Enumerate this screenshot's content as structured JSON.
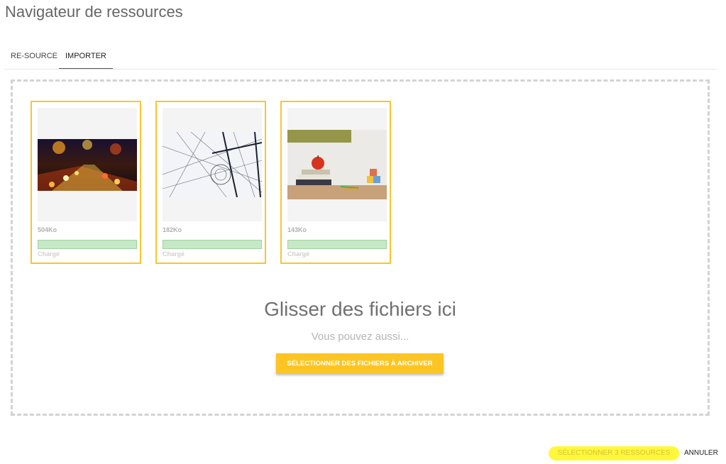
{
  "dialog": {
    "title": "Navigateur de ressources"
  },
  "tabs": [
    {
      "label": "RE-SOURCE",
      "active": false
    },
    {
      "label": "IMPORTER",
      "active": true
    }
  ],
  "uploads": [
    {
      "size": "504Ko",
      "status": "Chargé",
      "progress": 1.0
    },
    {
      "size": "182Ko",
      "status": "Chargé",
      "progress": 1.0
    },
    {
      "size": "143Ko",
      "status": "Chargé",
      "progress": 1.0
    }
  ],
  "dropzone": {
    "title": "Glisser des fichiers ici",
    "subtitle": "Vous pouvez aussi...",
    "select_button": "SÉLECTIONNER DES FICHIERS À ARCHIVER"
  },
  "footer": {
    "select_label": "SÉLECTIONNER 3 RESSOURCES",
    "cancel_label": "ANNULER"
  },
  "colors": {
    "accent": "#fcc523",
    "card_border": "#f7c531",
    "progress_fill": "#c6e8c6",
    "highlight": "#fff83a"
  }
}
